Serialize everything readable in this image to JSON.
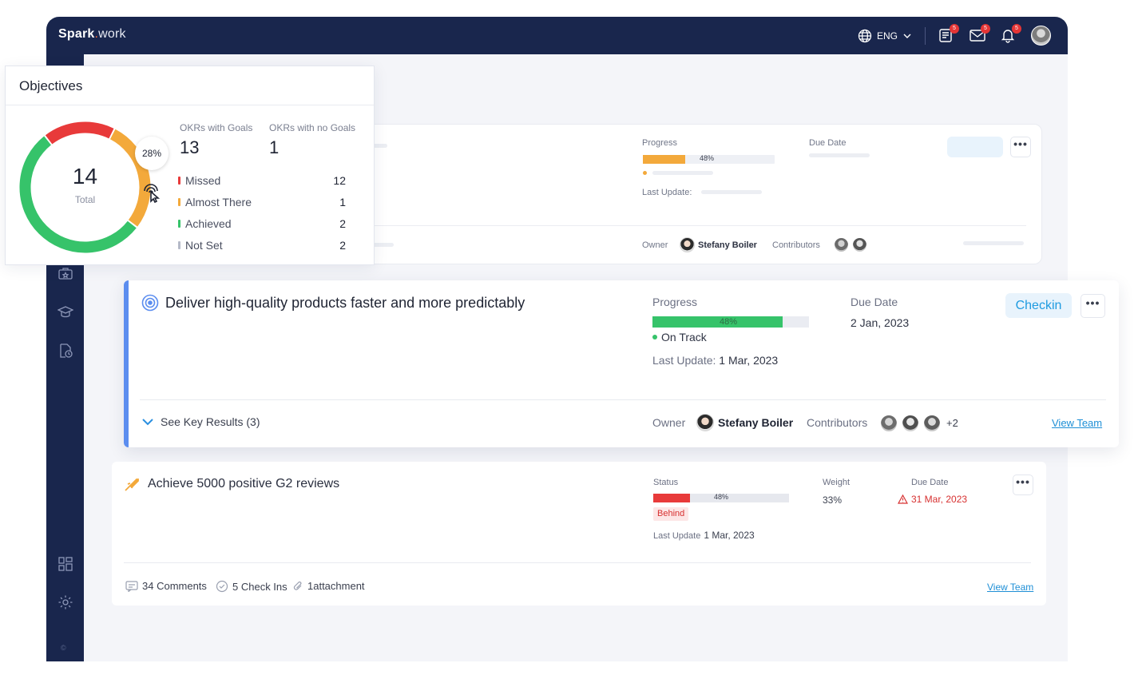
{
  "app": {
    "logo_main": "Spark",
    "logo_dot": ".",
    "logo_suffix": "work"
  },
  "topbar": {
    "lang": "ENG",
    "badges": {
      "notes": "5",
      "mail": "5",
      "bell": "5"
    }
  },
  "sidebar": {
    "copyright": "©"
  },
  "objectives_widget": {
    "title": "Objectives",
    "total_value": "14",
    "total_label": "Total",
    "hover_percent": "28%",
    "okrs_with_goals_label": "OKRs with Goals",
    "okrs_with_goals_value": "13",
    "okrs_no_goals_label": "OKRs with no Goals",
    "okrs_no_goals_value": "1",
    "legend": [
      {
        "label": "Missed",
        "count": "12",
        "color": "#e83a3a"
      },
      {
        "label": "Almost There",
        "count": "1",
        "color": "#f3a93b"
      },
      {
        "label": "Achieved",
        "count": "2",
        "color": "#36c36a"
      },
      {
        "label": "Not Set",
        "count": "2",
        "color": "#b5bac8"
      }
    ],
    "donut_segments": [
      {
        "name": "missed",
        "color": "#e83a3a",
        "fraction": 0.18
      },
      {
        "name": "almost-there",
        "color": "#f3a93b",
        "fraction": 0.28
      },
      {
        "name": "achieved",
        "color": "#36c36a",
        "fraction": 0.54
      }
    ]
  },
  "card_back": {
    "progress_label": "Progress",
    "progress_value": "48%",
    "progress_fraction": 0.32,
    "due_label": "Due Date",
    "last_update_label": "Last Update:",
    "owner_label": "Owner",
    "owner_name": "Stefany Boiler",
    "contributors_label": "Contributors"
  },
  "card_main": {
    "title": "Deliver high-quality products faster and more predictably",
    "progress_label": "Progress",
    "progress_value": "48%",
    "progress_fraction": 0.83,
    "status": "On Track",
    "last_update_label": "Last Update:",
    "last_update_value": "1 Mar, 2023",
    "due_label": "Due Date",
    "due_value": "2 Jan, 2023",
    "checkin_label": "Checkin",
    "see_key_results": "See Key Results (3)",
    "owner_label": "Owner",
    "owner_name": "Stefany Boiler",
    "contributors_label": "Contributors",
    "contributors_more": "+2",
    "view_team": "View Team"
  },
  "card_kr": {
    "title": "Achieve 5000 positive G2 reviews",
    "status_label": "Status",
    "progress_value": "48%",
    "progress_fraction": 0.27,
    "status_badge": "Behind",
    "last_update_label": "Last Update",
    "last_update_value": "1 Mar, 2023",
    "weight_label": "Weight",
    "weight_value": "33%",
    "due_label": "Due Date",
    "due_value": "31 Mar, 2023",
    "comments": "34 Comments",
    "checkins": "5 Check Ins",
    "attachment": "1attachment",
    "view_team": "View Team"
  }
}
